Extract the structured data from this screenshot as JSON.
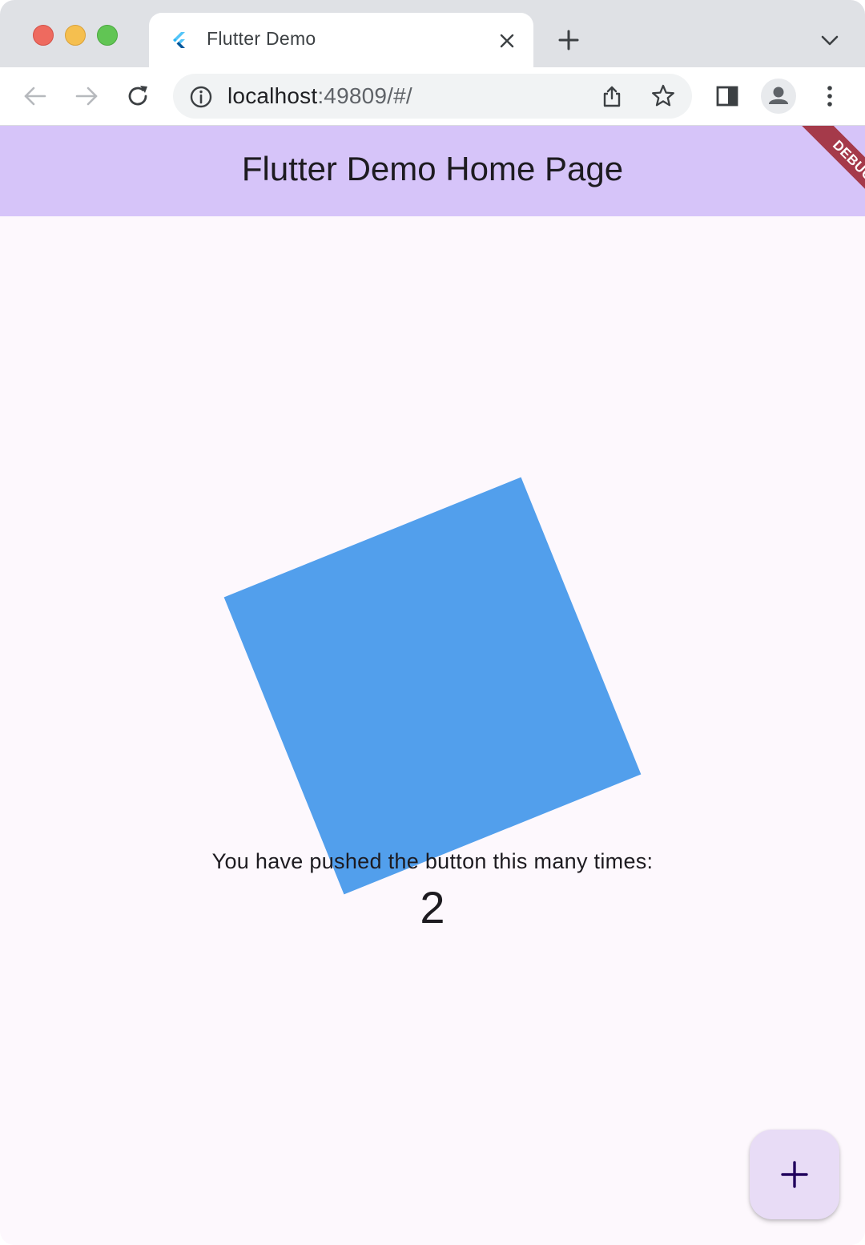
{
  "browser": {
    "tab": {
      "title": "Flutter Demo",
      "favicon": "flutter-logo-icon"
    },
    "omnibox": {
      "url_host": "localhost",
      "url_rest": ":49809/#/"
    },
    "icons": {
      "back": "arrow-left-icon",
      "forward": "arrow-right-icon",
      "reload": "reload-icon",
      "info": "info-icon",
      "share": "share-icon",
      "bookmark": "star-icon",
      "side_panel": "side-panel-icon",
      "profile": "profile-icon",
      "menu": "kebab-menu-icon",
      "new_tab": "plus-icon",
      "tab_search": "chevron-down-icon",
      "close_tab": "close-icon"
    }
  },
  "app": {
    "appbar_title": "Flutter Demo Home Page",
    "debug_banner": "DEBUG",
    "counter_label": "You have pushed the button this many times:",
    "counter_value": "2",
    "fab_icon": "plus-icon",
    "colors": {
      "appbar": "#d6c4f9",
      "square": "#529fec",
      "fab": "#e8dcf6",
      "debug_banner": "#a53a4a"
    }
  }
}
